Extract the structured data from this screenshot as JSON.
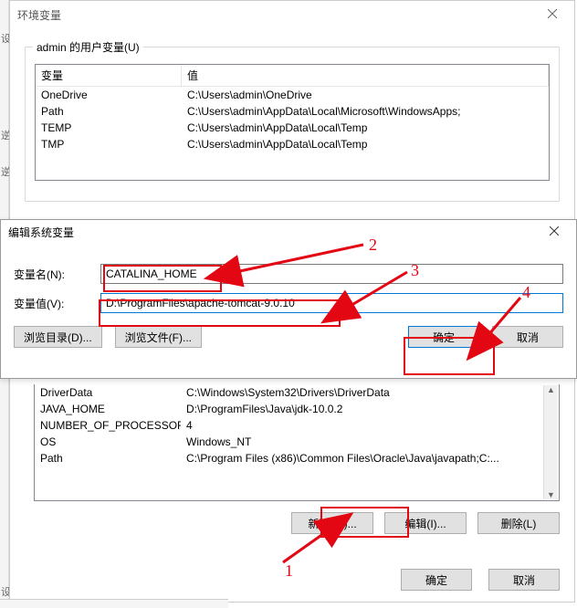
{
  "env_window": {
    "title": "环境变量",
    "user_group": {
      "legend": "admin 的用户变量(U)",
      "header_var": "变量",
      "header_val": "值",
      "rows": [
        {
          "var": "OneDrive",
          "val": "C:\\Users\\admin\\OneDrive"
        },
        {
          "var": "Path",
          "val": "C:\\Users\\admin\\AppData\\Local\\Microsoft\\WindowsApps;"
        },
        {
          "var": "TEMP",
          "val": "C:\\Users\\admin\\AppData\\Local\\Temp"
        },
        {
          "var": "TMP",
          "val": "C:\\Users\\admin\\AppData\\Local\\Temp"
        }
      ]
    },
    "sys_rows": [
      {
        "var": "DriverData",
        "val": "C:\\Windows\\System32\\Drivers\\DriverData"
      },
      {
        "var": "JAVA_HOME",
        "val": "D:\\ProgramFiles\\Java\\jdk-10.0.2"
      },
      {
        "var": "NUMBER_OF_PROCESSORS",
        "val": "4"
      },
      {
        "var": "OS",
        "val": "Windows_NT"
      },
      {
        "var": "Path",
        "val": "C:\\Program Files (x86)\\Common Files\\Oracle\\Java\\javapath;C:..."
      }
    ],
    "buttons": {
      "new": "新建(W)...",
      "edit": "编辑(I)...",
      "delete": "删除(L)",
      "ok": "确定",
      "cancel": "取消"
    }
  },
  "edit_window": {
    "title": "编辑系统变量",
    "label_name": "变量名(N):",
    "label_value": "变量值(V):",
    "name_value": "CATALINA_HOME",
    "value_value": "D:\\ProgramFiles\\apache-tomcat-9.0.10",
    "buttons": {
      "browse_dir": "浏览目录(D)...",
      "browse_file": "浏览文件(F)...",
      "ok": "确定",
      "cancel": "取消"
    }
  },
  "annotations": {
    "n1": "1",
    "n2": "2",
    "n3": "3",
    "n4": "4"
  },
  "stray": {
    "a": "设",
    "b": "逆",
    "c": "逆",
    "d": "设"
  }
}
